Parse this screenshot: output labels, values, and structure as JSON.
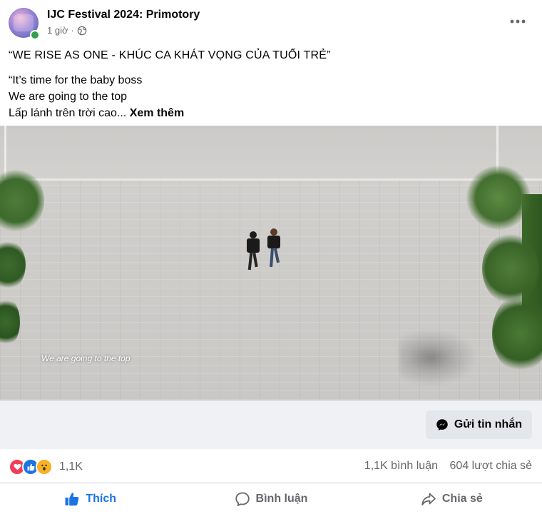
{
  "post": {
    "page_name": "IJC Festival 2024: Primotory",
    "time": "1 giờ",
    "privacy_icon": "globe-icon",
    "title_line": "“WE RISE AS ONE -  KHÚC CA KHÁT VỌNG CỦA TUỔI TRẺ”",
    "body_lines": [
      "“It’s time for the baby boss",
      "We are going to the top",
      "Lấp lánh trên trời cao..."
    ],
    "see_more": "Xem thêm"
  },
  "video": {
    "caption": "We are going to the top"
  },
  "cta": {
    "message_button": "Gửi tin nhắn"
  },
  "stats": {
    "reaction_count": "1,1K",
    "comments": "1,1K bình luận",
    "shares": "604 lượt chia sẻ"
  },
  "actions": {
    "like": "Thích",
    "comment": "Bình luận",
    "share": "Chia sẻ"
  },
  "colors": {
    "accent": "#1b74e4",
    "muted_text": "#65676b",
    "online": "#31a24c"
  }
}
